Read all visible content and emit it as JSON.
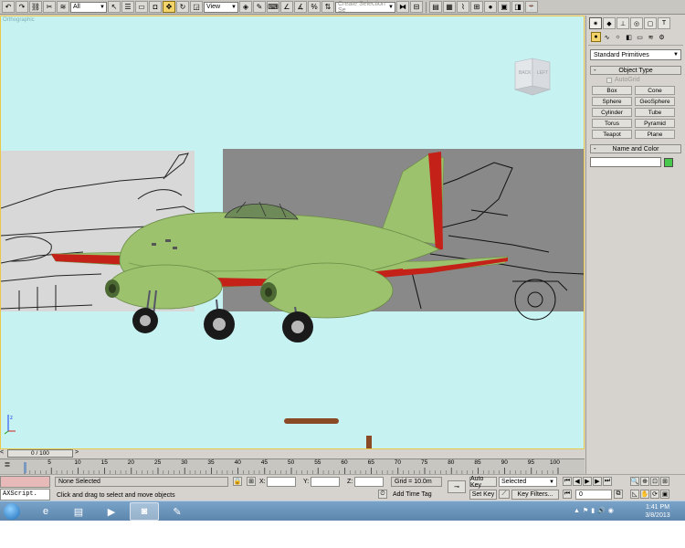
{
  "toolbar": {
    "selection_filter": "All",
    "reference_coord": "View",
    "named_selection_placeholder": "Create Selection Se"
  },
  "viewport": {
    "label": "Orthographic",
    "viewcube_back": "BACK",
    "viewcube_left": "LEFT",
    "axis_label": "z"
  },
  "command_panel": {
    "tabs": [
      "create-tab",
      "modify-tab",
      "hierarchy-tab",
      "motion-tab",
      "display-tab",
      "utilities-tab"
    ],
    "category": "Standard Primitives",
    "object_type_title": "Object Type",
    "autogrid_label": "AutoGrid",
    "primitives": [
      "Box",
      "Cone",
      "Sphere",
      "GeoSphere",
      "Cylinder",
      "Tube",
      "Torus",
      "Pyramid",
      "Teapot",
      "Plane"
    ],
    "name_color_title": "Name and Color",
    "object_color": "#47c84d"
  },
  "timeslider": {
    "frame_display": "0 / 100",
    "prev_label": "<",
    "next_label": ">"
  },
  "trackbar": {
    "ticks": [
      "5",
      "10",
      "15",
      "20",
      "25",
      "30",
      "35",
      "40",
      "45",
      "50",
      "55",
      "60",
      "65",
      "70",
      "75",
      "80",
      "85",
      "90",
      "95",
      "100"
    ]
  },
  "status": {
    "maxscript_label": "AXScript.",
    "selection_info": "None Selected",
    "prompt": "Click and drag to select and move objects",
    "x_label": "X:",
    "y_label": "Y:",
    "z_label": "Z:",
    "grid": "Grid = 10.0m",
    "add_time_tag": "Add Time Tag",
    "auto_key": "Auto Key",
    "set_key": "Set Key",
    "selected_option": "Selected",
    "key_filters": "Key Filters...",
    "current_frame": "0"
  },
  "taskbar": {
    "time": "1:41 PM",
    "date": "3/8/2013"
  }
}
